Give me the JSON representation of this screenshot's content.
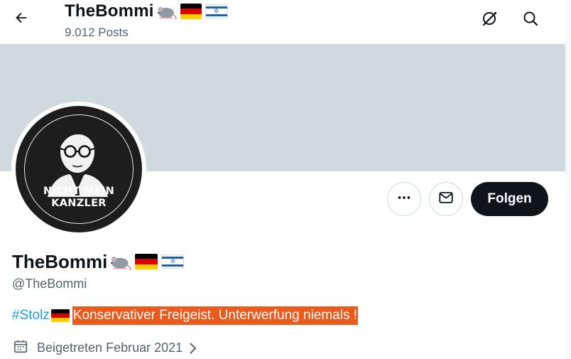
{
  "header": {
    "display_name": "TheBommi",
    "posts_count": "9.012 Posts",
    "back_icon": "arrow-left-icon",
    "grok_icon": "grok-icon",
    "search_icon": "search-icon"
  },
  "profile": {
    "display_name": "TheBommi",
    "handle": "@TheBommi",
    "avatar_caption_line1": "NICHT MEIN",
    "avatar_caption_line2": "KANZLER",
    "bio": {
      "hashtag": "#Stolz",
      "text": "Konservativer Freigeist. Unterwerfung niemals !",
      "highlight_color": "#e95a1c"
    },
    "joined": "Beigetreten Februar 2021"
  },
  "actions": {
    "more_icon": "more-horizontal-icon",
    "message_icon": "envelope-icon",
    "follow_label": "Folgen"
  },
  "colors": {
    "banner": "#cfd9de",
    "accent": "#1d9bf0",
    "text_primary": "#0f1419",
    "text_secondary": "#536471"
  }
}
